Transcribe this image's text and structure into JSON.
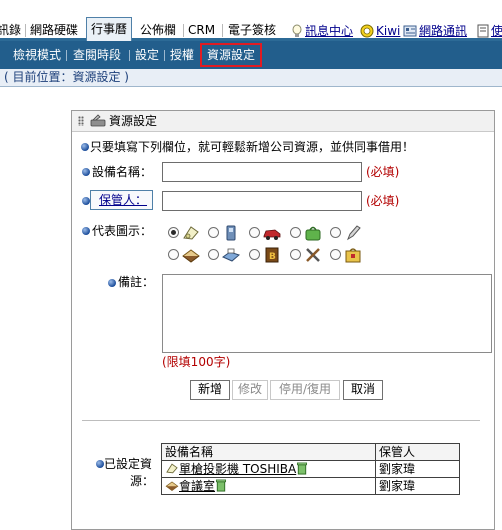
{
  "top_tabs": [
    "訊錄",
    "網路硬碟",
    "行事曆",
    "公佈欄",
    "CRM",
    "電子簽核"
  ],
  "top_links": {
    "messages": "訊息中心",
    "user": "Kiwi",
    "contacts": "網路通訊",
    "overflow": "使"
  },
  "sub_menu": [
    "檢視模式",
    "查閱時段",
    "設定",
    "授權",
    "資源設定"
  ],
  "breadcrumb": "( 目前位置：資源設定 )",
  "panel": {
    "title": "資源設定",
    "intro": "只要填寫下列欄位，就可輕鬆新增公司資源，並供同事借用！",
    "device_label": "設備名稱：",
    "keeper_label": "保管人：",
    "required": "(必填)",
    "icon_label": "代表圖示：",
    "note_label": "備註：",
    "note_limit": "(限填100字)",
    "buttons": {
      "add": "新增",
      "edit": "修改",
      "toggle": "停用/復用",
      "cancel": "取消"
    },
    "icons": [
      "projector-icon",
      "phone-icon",
      "car-icon",
      "bag-icon",
      "pen-icon",
      "meeting-room-icon",
      "scanner-icon",
      "book-icon",
      "tools-icon",
      "box-icon"
    ],
    "list_label_line1": "已設定資",
    "list_label_line2": "源：",
    "table": {
      "headers": [
        "設備名稱",
        "保管人"
      ],
      "rows": [
        {
          "name": "單槍投影機 TOSHIBA",
          "keeper": "劉家瑋"
        },
        {
          "name": "會議室",
          "keeper": "劉家瑋"
        }
      ]
    }
  },
  "colors": {
    "submenu_bg": "#225e8c",
    "highlight": "#e11b22",
    "required": "#b30000"
  }
}
